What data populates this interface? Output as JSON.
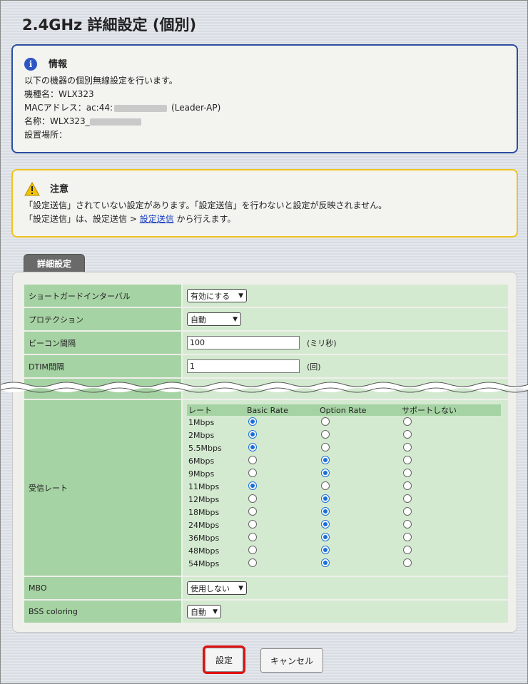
{
  "page": {
    "title": "2.4GHz 詳細設定 (個別)"
  },
  "info": {
    "heading": "情報",
    "lines": {
      "intro": "以下の機器の個別無線設定を行います。",
      "model": "機種名：WLX323",
      "mac_prefix": "MACアドレス：ac:44:",
      "mac_suffix": "(Leader-AP)",
      "name_prefix": "名称：WLX323_",
      "location": "設置場所："
    }
  },
  "warning": {
    "heading": "注意",
    "line1": "「設定送信」されていない設定があります。「設定送信」を行わないと設定が反映されません。",
    "line2_prefix": "「設定送信」は、設定送信 > ",
    "line2_link": "設定送信",
    "line2_suffix": " から行えます。"
  },
  "tab": {
    "label": "詳細設定"
  },
  "settings": {
    "short_gi": {
      "label": "ショートガードインターバル",
      "value": "有効にする"
    },
    "protection": {
      "label": "プロテクション",
      "value": "自動"
    },
    "beacon": {
      "label": "ビーコン間隔",
      "value": "100",
      "unit": "(ミリ秒)"
    },
    "dtim": {
      "label": "DTIM間隔",
      "value": "1",
      "unit": "(回)"
    },
    "rx_rate": {
      "label": "受信レート",
      "headers": [
        "レート",
        "Basic Rate",
        "Option Rate",
        "サポートしない"
      ],
      "rates": [
        {
          "name": "1Mbps",
          "selected": "basic"
        },
        {
          "name": "2Mbps",
          "selected": "basic"
        },
        {
          "name": "5.5Mbps",
          "selected": "basic"
        },
        {
          "name": "6Mbps",
          "selected": "option"
        },
        {
          "name": "9Mbps",
          "selected": "option"
        },
        {
          "name": "11Mbps",
          "selected": "basic"
        },
        {
          "name": "12Mbps",
          "selected": "option"
        },
        {
          "name": "18Mbps",
          "selected": "option"
        },
        {
          "name": "24Mbps",
          "selected": "option"
        },
        {
          "name": "36Mbps",
          "selected": "option"
        },
        {
          "name": "48Mbps",
          "selected": "option"
        },
        {
          "name": "54Mbps",
          "selected": "option"
        }
      ]
    },
    "mbo": {
      "label": "MBO",
      "value": "使用しない"
    },
    "bss": {
      "label": "BSS coloring",
      "value": "自動"
    }
  },
  "buttons": {
    "set": "設定",
    "cancel": "キャンセル"
  },
  "colors": {
    "info_border": "#2c4ea0",
    "warn_border": "#f0c31c",
    "label_bg": "#a6d3a4",
    "value_bg": "#d4ead0",
    "highlight": "#e01010"
  }
}
